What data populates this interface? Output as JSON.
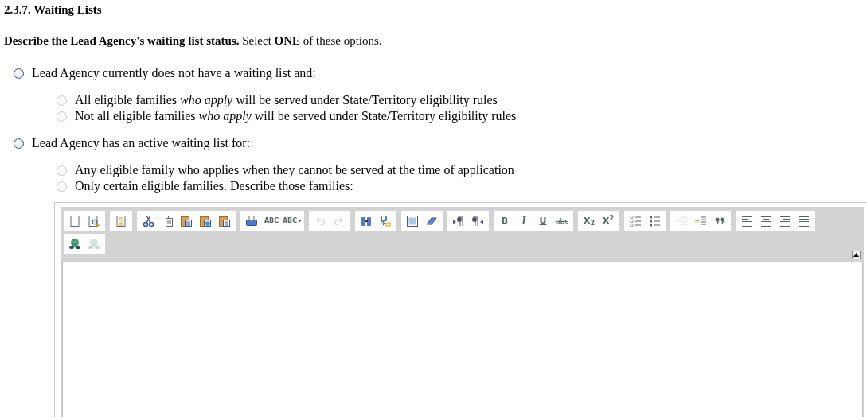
{
  "section_title": "2.3.7. Waiting Lists",
  "question": "**Describe the Lead Agency's waiting list status.** Select **ONE** of these options.",
  "options": [
    {
      "label": "Lead Agency currently does not have a waiting list and:",
      "selected": false,
      "disabled": false,
      "children": [
        {
          "label": "All eligible families *who apply* will be served under State/Territory eligibility rules",
          "selected": false,
          "disabled": true
        },
        {
          "label": "Not all eligible families *who apply* will be served under State/Territory eligibility rules",
          "selected": false,
          "disabled": true
        }
      ]
    },
    {
      "label": "Lead Agency has an active waiting list for:",
      "selected": false,
      "disabled": false,
      "children": [
        {
          "label": "Any eligible family who applies when they cannot be served at the time of application",
          "selected": false,
          "disabled": true
        },
        {
          "label": "Only certain eligible families. Describe those families:",
          "selected": false,
          "disabled": true
        }
      ]
    }
  ],
  "editor": {
    "toolbar_rows": [
      [
        [
          {
            "kind": "new",
            "disabled": false
          },
          {
            "kind": "preview",
            "disabled": false
          }
        ],
        [
          {
            "kind": "templates",
            "disabled": false
          }
        ],
        [
          {
            "kind": "cut",
            "disabled": false
          },
          {
            "kind": "copy",
            "disabled": false
          },
          {
            "kind": "paste",
            "disabled": false
          },
          {
            "kind": "paste-word",
            "disabled": false
          },
          {
            "kind": "paste-text",
            "disabled": false
          }
        ],
        [
          {
            "kind": "print",
            "disabled": false
          },
          {
            "kind": "spellcheck",
            "disabled": false,
            "label": "ABC"
          },
          {
            "kind": "spellcheck-menu",
            "disabled": false,
            "label": "ABC"
          }
        ],
        [
          {
            "kind": "undo",
            "disabled": true
          },
          {
            "kind": "redo",
            "disabled": true
          }
        ],
        [
          {
            "kind": "find",
            "disabled": false
          },
          {
            "kind": "replace",
            "disabled": false
          }
        ],
        [
          {
            "kind": "select-all",
            "disabled": false
          },
          {
            "kind": "eraser",
            "disabled": false
          }
        ],
        [
          {
            "kind": "ltr",
            "disabled": false
          },
          {
            "kind": "rtl",
            "disabled": false
          }
        ],
        [
          {
            "kind": "bold",
            "disabled": false,
            "label": "B"
          },
          {
            "kind": "italic",
            "disabled": false,
            "label": "I"
          },
          {
            "kind": "underline",
            "disabled": false,
            "label": "U"
          },
          {
            "kind": "strike",
            "disabled": false,
            "label": "abc"
          }
        ],
        [
          {
            "kind": "subscript",
            "disabled": false,
            "label": "X",
            "script": "2"
          },
          {
            "kind": "superscript",
            "disabled": false,
            "label": "X",
            "script": "2"
          }
        ],
        [
          {
            "kind": "numbered-list",
            "disabled": false
          },
          {
            "kind": "bullet-list",
            "disabled": false
          }
        ],
        [
          {
            "kind": "outdent",
            "disabled": true
          },
          {
            "kind": "indent",
            "disabled": false
          },
          {
            "kind": "quote",
            "disabled": false
          }
        ],
        [
          {
            "kind": "align-left",
            "disabled": false
          },
          {
            "kind": "align-center",
            "disabled": false
          },
          {
            "kind": "align-right",
            "disabled": false
          },
          {
            "kind": "justify",
            "disabled": false
          }
        ]
      ],
      [
        [
          {
            "kind": "link",
            "disabled": false
          },
          {
            "kind": "unlink",
            "disabled": true
          }
        ]
      ]
    ]
  }
}
